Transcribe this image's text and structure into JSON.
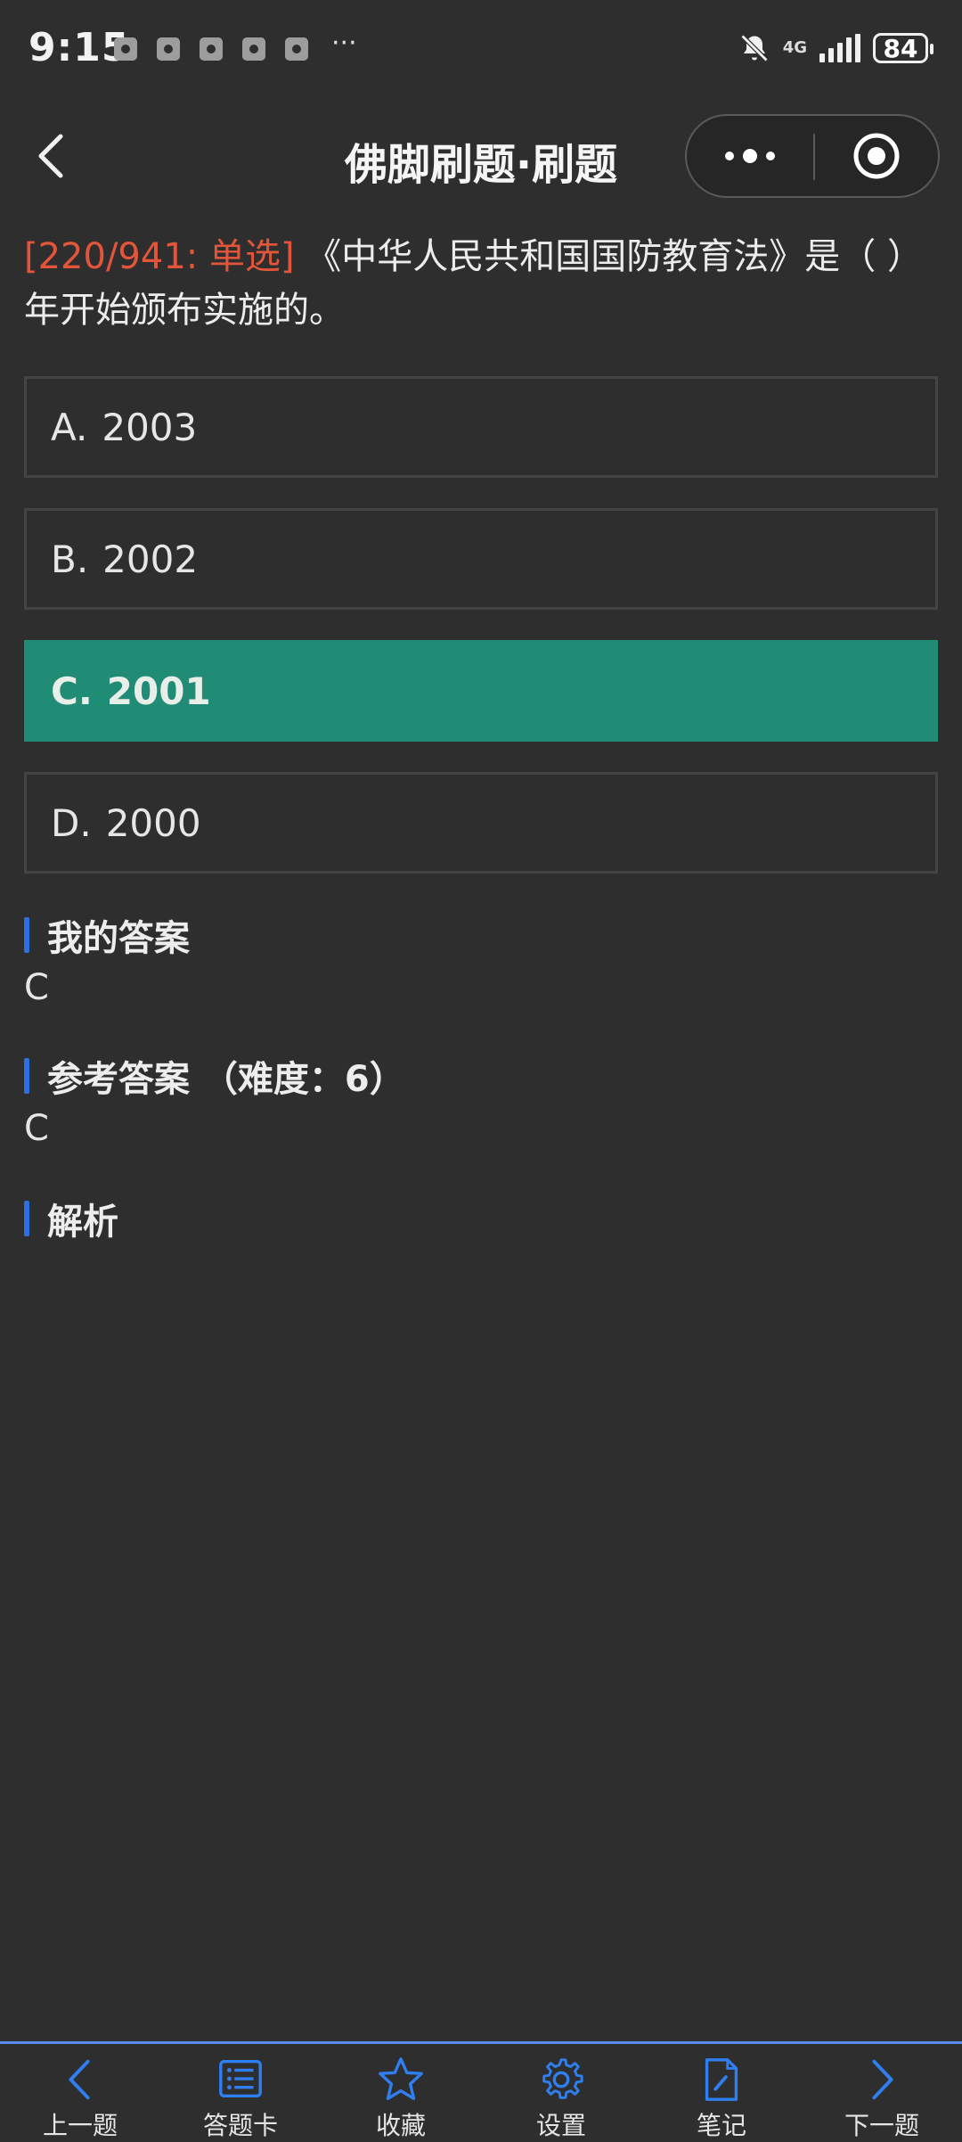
{
  "status_bar": {
    "time": "9:15",
    "network": "4G",
    "battery": "84"
  },
  "header": {
    "title": "佛脚刷题·刷题"
  },
  "question": {
    "prefix": "[220/941: 单选]",
    "text": "《中华人民共和国国防教育法》是（ ）年开始颁布实施的。"
  },
  "options": [
    {
      "letter": "A.",
      "text": "2003"
    },
    {
      "letter": "B.",
      "text": "2002"
    },
    {
      "letter": "C.",
      "text": "2001"
    },
    {
      "letter": "D.",
      "text": "2000"
    }
  ],
  "my_answer": {
    "title": "我的答案",
    "value": "C"
  },
  "reference_answer": {
    "title": "参考答案 （难度：6）",
    "value": "C"
  },
  "analysis": {
    "title": "解析"
  },
  "bottom_nav": [
    {
      "label": "上一题",
      "icon": "chevron-left-icon"
    },
    {
      "label": "答题卡",
      "icon": "list-icon"
    },
    {
      "label": "收藏",
      "icon": "star-icon"
    },
    {
      "label": "设置",
      "icon": "gear-icon"
    },
    {
      "label": "笔记",
      "icon": "note-edit-icon"
    },
    {
      "label": "下一题",
      "icon": "chevron-right-icon"
    }
  ],
  "colors": {
    "background": "#2e2e2e",
    "selected_option": "#218c76",
    "accent_blue": "#2f6fe6",
    "question_prefix": "#e3553b"
  }
}
